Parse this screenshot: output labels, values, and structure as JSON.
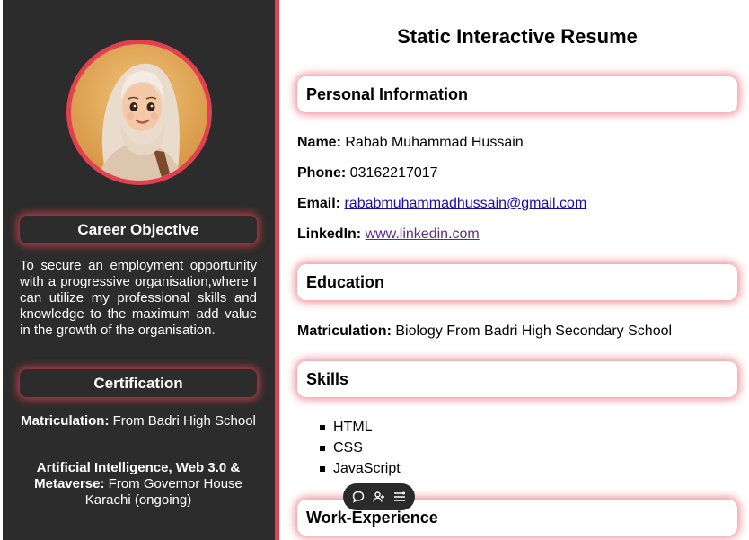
{
  "sidebar": {
    "avatar_icon": "profile-avatar-hijab-girl",
    "career_objective": {
      "heading": "Career Objective",
      "text": "To secure an employment opportunity with a progressive organisation,where I can utilize my professional skills and knowledge to the maximum add value in the growth of the organisation."
    },
    "certification": {
      "heading": "Certification",
      "items": [
        {
          "title": "Matriculation:",
          "detail": " From Badri High School"
        },
        {
          "title": "Artificial Intelligence, Web 3.0 & Metaverse:",
          "detail": " From Governor House Karachi (ongoing)"
        }
      ]
    }
  },
  "main": {
    "title": "Static Interactive Resume",
    "personal_info": {
      "heading": "Personal Information",
      "name_label": "Name:",
      "name_value": "Rabab Muhammad Hussain",
      "phone_label": "Phone:",
      "phone_value": "03162217017",
      "email_label": "Email:",
      "email_value": "rababmuhammadhussain@gmail.com",
      "linkedin_label": "LinkedIn:",
      "linkedin_value": "www.linkedin.com"
    },
    "education": {
      "heading": "Education",
      "label": "Matriculation:",
      "value": "Biology From Badri High Secondary School"
    },
    "skills": {
      "heading": "Skills",
      "items": [
        "HTML",
        "CSS",
        "JavaScript"
      ]
    },
    "work_experience": {
      "heading": "Work-Experience"
    }
  },
  "floating_toolbar": {
    "icons": [
      "comment-icon",
      "add-person-icon",
      "list-settings-icon"
    ]
  },
  "colors": {
    "sidebar_bg": "#2c2c2c",
    "accent": "#e0404f",
    "link": "#1a0dab",
    "visited_link": "#5b2b8c"
  }
}
